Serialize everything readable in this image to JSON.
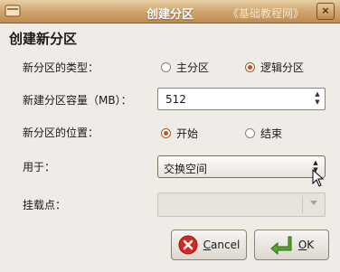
{
  "window": {
    "title": "创建分区",
    "watermark": "《基础教程网》",
    "close_glyph": "×"
  },
  "dialog": {
    "heading": "创建新分区",
    "type_label": "新分区的类型：",
    "type_options": [
      "主分区",
      "逻辑分区"
    ],
    "type_selected": "逻辑分区",
    "size_label": "新建分区容量（MB）：",
    "size_value": "512",
    "position_label": "新分区的位置：",
    "position_options": [
      "开始",
      "结束"
    ],
    "position_selected": "开始",
    "use_label": "用于：",
    "use_value": "交换空间",
    "mount_label": "挂载点：",
    "mount_value": ""
  },
  "buttons": {
    "cancel_mnemonic": "C",
    "cancel_rest": "ancel",
    "ok_mnemonic": "O",
    "ok_rest": "K"
  },
  "colors": {
    "radio_selected": "#c2561c",
    "titlebar": "#d2a872"
  }
}
